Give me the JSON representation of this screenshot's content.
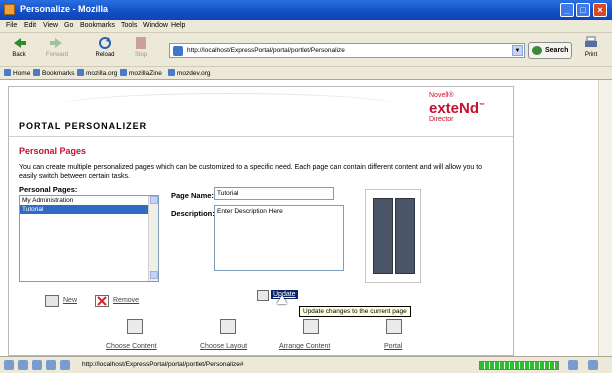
{
  "window": {
    "title": "Personalize - Mozilla"
  },
  "menu": [
    "File",
    "Edit",
    "View",
    "Go",
    "Bookmarks",
    "Tools",
    "Window",
    "Help"
  ],
  "toolbar": {
    "back": "Back",
    "forward": "Forward",
    "reload": "Reload",
    "stop": "Stop",
    "url": "http://localhost/ExpressPortal/portal/portlet/Personalize",
    "search": "Search",
    "print": "Print"
  },
  "bookmarks": [
    "Home",
    "Bookmarks",
    "mozilla.org",
    "mozillaZine",
    "mozdev.org"
  ],
  "portal": {
    "title": "PORTAL PERSONALIZER",
    "brand": {
      "line1": "Novell®",
      "line2": "exteNd",
      "trademark": "™",
      "line3": "Director"
    }
  },
  "section": {
    "title": "Personal Pages",
    "description": "You can create multiple personalized pages which can be customized to a specific need. Each page can contain different content and will allow you to easily switch between certain tasks.",
    "pages_label": "Personal Pages:",
    "pages": [
      {
        "label": "My Administration",
        "selected": false
      },
      {
        "label": "Tutorial",
        "selected": true
      }
    ],
    "page_name_label": "Page Name:",
    "page_name_value": "Tutorial",
    "description_label": "Description:",
    "description_value": "Enter Description Here",
    "new": "New",
    "remove": "Remove",
    "update": "Update",
    "update_tooltip": "Update changes to the current page",
    "links": [
      "Choose Content",
      "Choose Layout",
      "Arrange Content",
      "Portal"
    ]
  },
  "status": {
    "url": "http://localhost/ExpressPortal/portal/portlet/Personalize#"
  },
  "colors": {
    "accent": "#c8102e",
    "selection": "#316ac5",
    "titlebar": "#1450c8"
  }
}
